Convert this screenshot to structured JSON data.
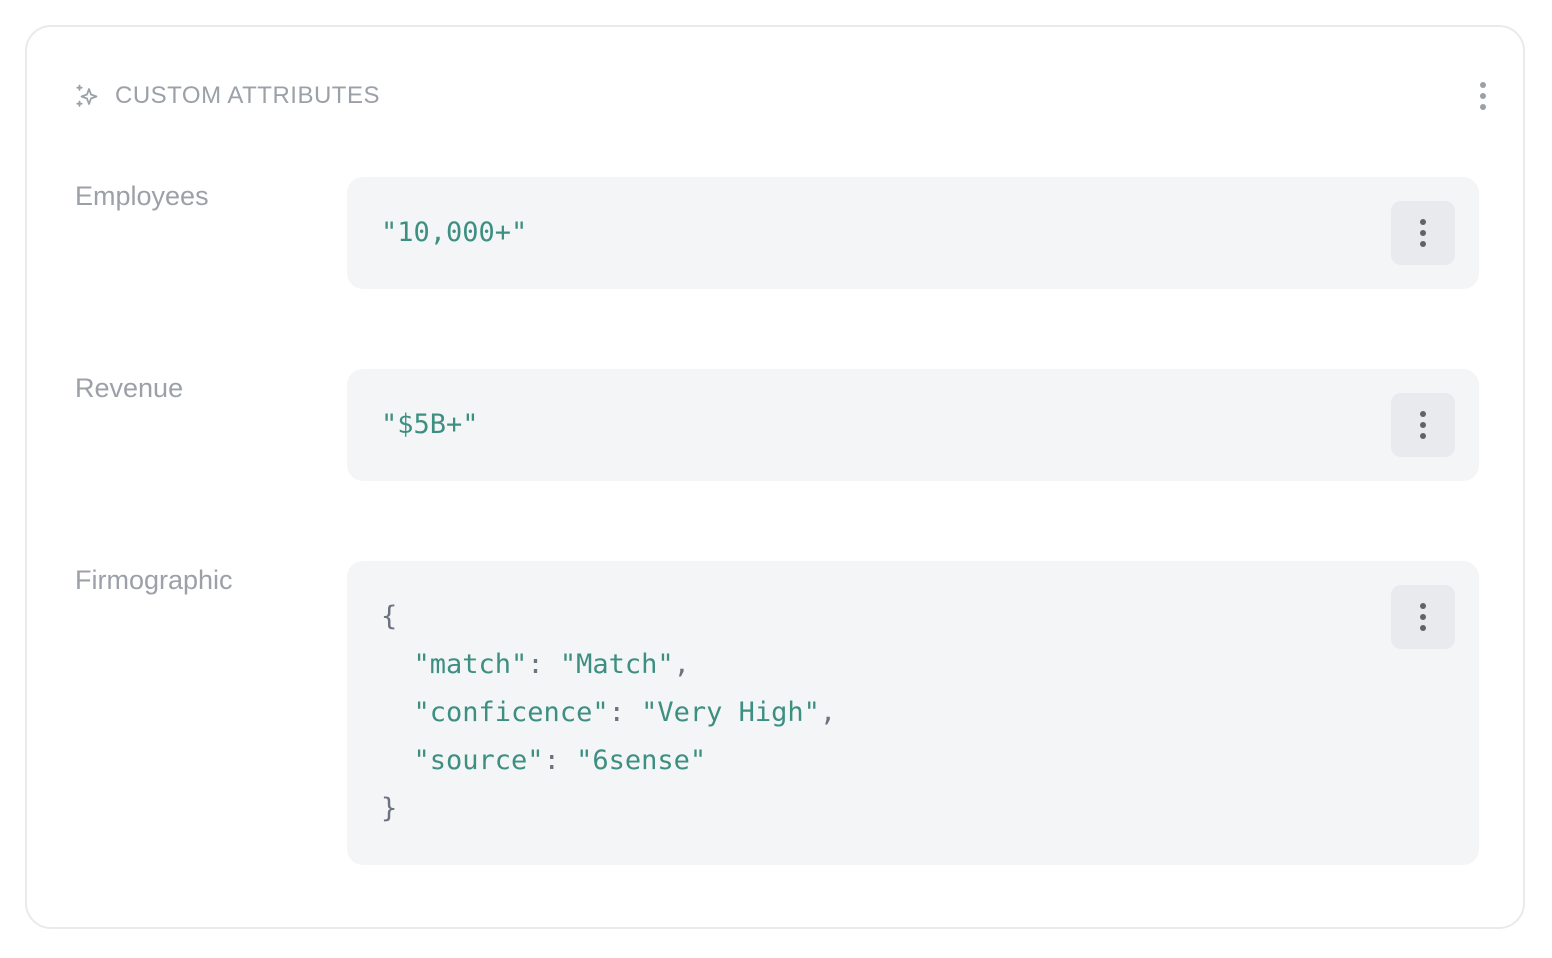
{
  "header": {
    "title": "CUSTOM ATTRIBUTES",
    "icon": "sparkle-icon",
    "menu_icon": "more-vertical-icon"
  },
  "attributes": [
    {
      "label": "Employees",
      "value": "\"10,000+\""
    },
    {
      "label": "Revenue",
      "value": "\"$5B+\""
    },
    {
      "label": "Firmographic",
      "json": {
        "open": "{",
        "close": "}",
        "entries": [
          {
            "key": "\"match\"",
            "value": "\"Match\"",
            "comma": ","
          },
          {
            "key": "\"conficence\"",
            "value": "\"Very High\"",
            "comma": ","
          },
          {
            "key": "\"source\"",
            "value": "\"6sense\"",
            "comma": ""
          }
        ]
      }
    }
  ],
  "colors": {
    "code_value": "#3d8f82",
    "label": "#9ca0a8",
    "box_bg": "#f4f5f7"
  }
}
